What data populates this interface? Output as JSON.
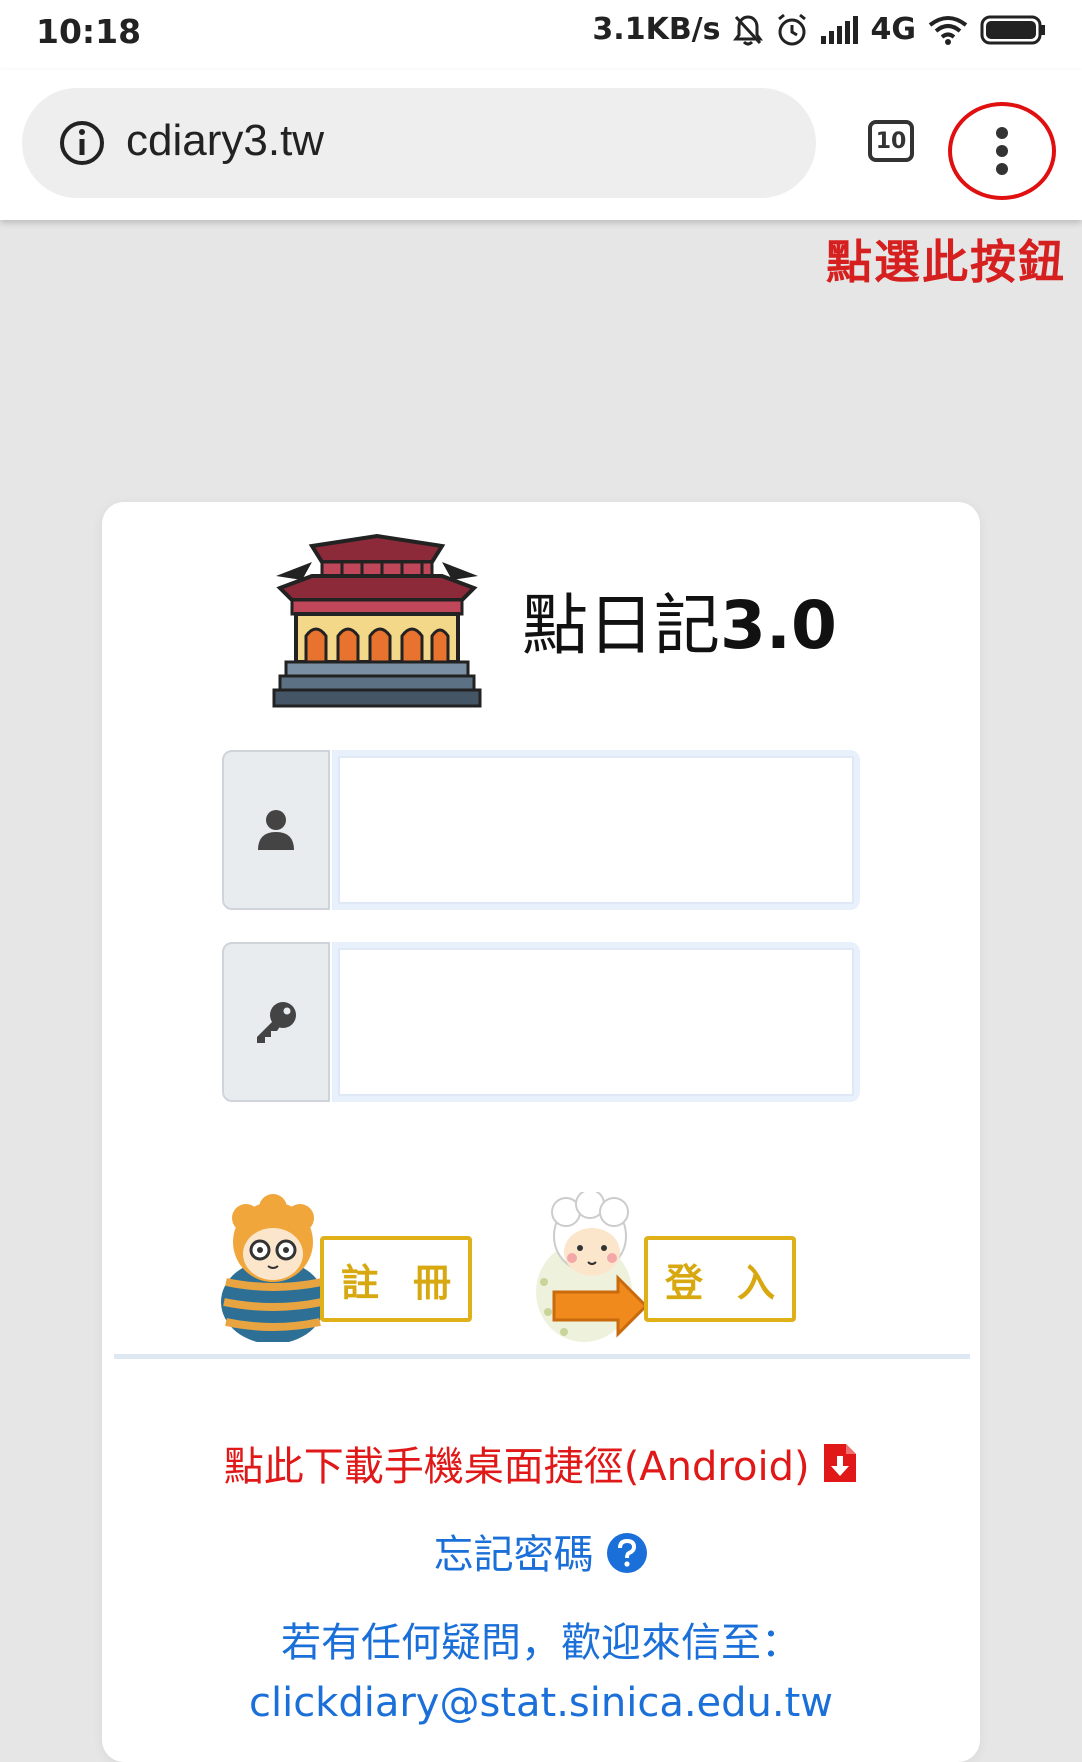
{
  "status_bar": {
    "time": "10:18",
    "net_speed": "3.1KB/s",
    "network": "4G"
  },
  "browser": {
    "url": "cdiary3.tw",
    "tab_count": "10"
  },
  "annotation": "點選此按鈕",
  "app": {
    "title_zh": "點日記",
    "title_version": "3.0"
  },
  "buttons": {
    "register": [
      "註",
      "冊"
    ],
    "login": [
      "登",
      "入"
    ]
  },
  "links": {
    "download_shortcut": "點此下載手機桌面捷徑(Android)",
    "forgot_password": "忘記密碼",
    "contact": "若有任何疑問，歡迎來信至：",
    "email": "clickdiary@stat.sinica.edu.tw"
  },
  "colors": {
    "annotation_red": "#d62020",
    "link_red": "#e01818",
    "link_blue": "#1a6fd8",
    "button_gold": "#e0b018"
  }
}
